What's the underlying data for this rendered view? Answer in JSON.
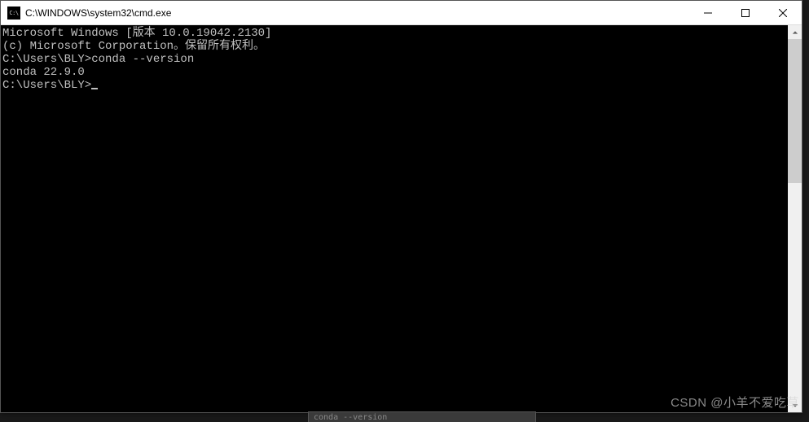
{
  "window": {
    "icon_text": "C:\\",
    "title": "C:\\WINDOWS\\system32\\cmd.exe"
  },
  "terminal": {
    "line1": "Microsoft Windows [版本 10.0.19042.2130]",
    "line2": "(c) Microsoft Corporation。保留所有权利。",
    "blank1": "",
    "prompt1": "C:\\Users\\BLY>conda --version",
    "output1": "conda 22.9.0",
    "blank2": "",
    "prompt2": "C:\\Users\\BLY>"
  },
  "taskbar": {
    "text": "conda --version"
  },
  "watermark": "CSDN @小羊不爱吃草"
}
